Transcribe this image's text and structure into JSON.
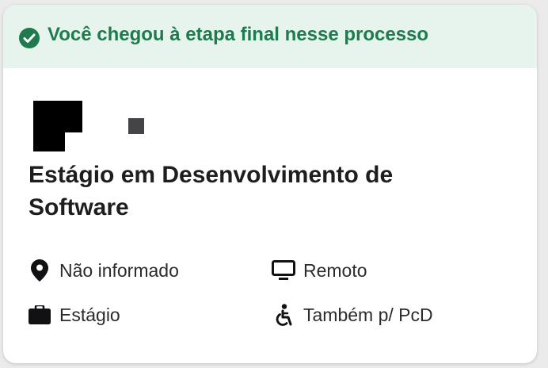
{
  "banner": {
    "text": "Você chegou à etapa final nesse processo",
    "icon": "check-circle-icon",
    "color": "#1f7a4d",
    "background": "#e7f4ee"
  },
  "job": {
    "title": "Estágio em Desenvolvimento de Software",
    "details": [
      {
        "icon": "location-pin-icon",
        "label": "Não informado"
      },
      {
        "icon": "monitor-icon",
        "label": "Remoto"
      },
      {
        "icon": "briefcase-icon",
        "label": "Estágio"
      },
      {
        "icon": "accessibility-icon",
        "label": "Também p/ PcD"
      }
    ]
  }
}
